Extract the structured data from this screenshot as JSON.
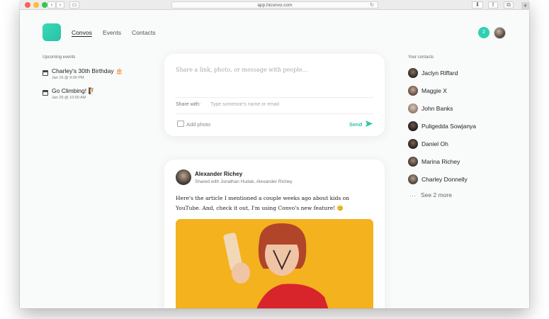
{
  "browser": {
    "url": "app.hiconvo.com",
    "icons": [
      "back-icon",
      "forward-icon",
      "sidebar-icon",
      "reload-icon",
      "download-icon",
      "share-icon",
      "tabs-icon",
      "new-tab-icon"
    ]
  },
  "nav": {
    "items": [
      "Convos",
      "Events",
      "Contacts"
    ],
    "active": "Convos",
    "notification_count": "2"
  },
  "events": {
    "title": "Upcoming events",
    "items": [
      {
        "title": "Charley's 30th Birthday 🎂",
        "time": "Jan 16 @ 9:00 PM"
      },
      {
        "title": "Go Climbing! 🧗",
        "time": "Jan 25 @ 10:00 AM"
      }
    ]
  },
  "compose": {
    "placeholder": "Share a link, photo, or message with people...",
    "share_label": "Share with:",
    "share_placeholder": "Type someone's name or email",
    "add_photo": "Add photo",
    "send": "Send"
  },
  "post": {
    "author": "Alexander Richey",
    "shared_with": "Shared with Jonathan Hudak, Alexander Richey",
    "text": "Here's the article I mentioned a couple weeks ago about kids on YouTube. And, check it out, I'm using Convo's new feature! 😊"
  },
  "contacts": {
    "title": "Your contacts",
    "items": [
      "Jaclyn Riffard",
      "Maggie X",
      "John Banks",
      "Puligedda Sowjanya",
      "Daniel Oh",
      "Marina Richey",
      "Charley Donnelly"
    ],
    "more_label": "See 2 more"
  },
  "colors": {
    "accent": "#2bc4a7",
    "logo": "#3ad9b6",
    "image_background": "#f3b21e"
  }
}
